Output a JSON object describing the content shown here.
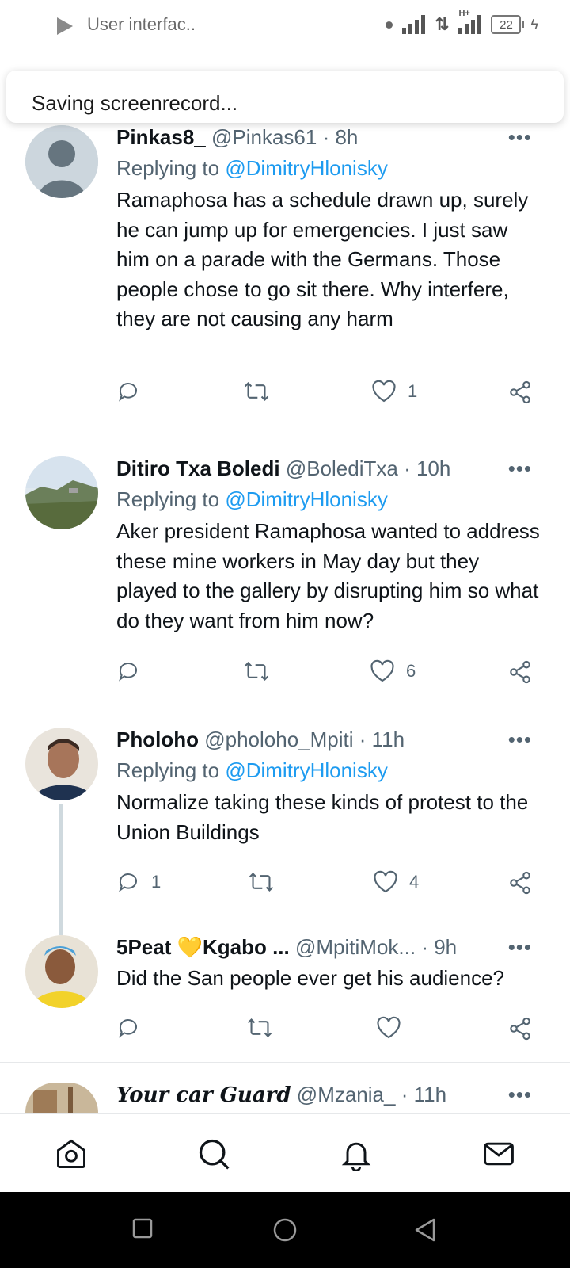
{
  "status_bar": {
    "title": "User interfac..",
    "network": "H+",
    "battery": "22"
  },
  "toast": {
    "text": "Saving screenrecord..."
  },
  "tweets": [
    {
      "name": "Pinkas8_",
      "handle": "@Pinkas61",
      "time": "· 8h",
      "replying_label": "Replying to",
      "replying_to": "@DimitryHlonisky",
      "text": "Ramaphosa has a schedule drawn up, surely he can jump up for emergencies. I just saw him on a parade with the Germans. Those people chose to go sit there. Why interfere, they are not causing any harm",
      "reply_count": "",
      "like_count": "1"
    },
    {
      "name": "Ditiro Txa Boledi",
      "handle": "@BolediTxa",
      "time": "· 10h",
      "replying_label": "Replying to",
      "replying_to": "@DimitryHlonisky",
      "text": "Aker president Ramaphosa wanted to address these mine workers in May day but they played to the gallery by disrupting him so what do they want from him now?",
      "reply_count": "",
      "like_count": "6"
    },
    {
      "name": "Pholoho",
      "handle": "@pholoho_Mpiti",
      "time": "· 11h",
      "replying_label": "Replying to",
      "replying_to": "@DimitryHlonisky",
      "text": "Normalize taking these kinds of protest to the Union Buildings",
      "reply_count": "1",
      "like_count": "4"
    },
    {
      "name": "5Peat 💛Kgabo ...",
      "handle": "@MpitiMok...",
      "time": "· 9h",
      "text": "Did the San people ever get his audience?",
      "reply_count": "",
      "like_count": ""
    },
    {
      "name": "Your car Guard",
      "handle": "@Mzania_",
      "time": "· 11h"
    }
  ],
  "more_label": "•••",
  "colors": {
    "link": "#1d9bf0",
    "muted": "#536471",
    "text": "#0f1419"
  },
  "bottom_nav": [
    "home-icon",
    "search-icon",
    "notifications-icon",
    "messages-icon"
  ],
  "system_nav": [
    "recents-icon",
    "home-circle-icon",
    "back-icon"
  ]
}
